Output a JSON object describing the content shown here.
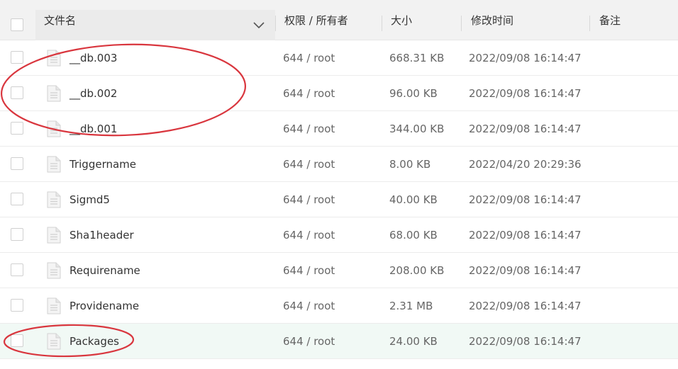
{
  "columns": {
    "name": "文件名",
    "perm": "权限 / 所有者",
    "size": "大小",
    "mtime": "修改时间",
    "note": "备注"
  },
  "rows": [
    {
      "name": "__db.003",
      "perm": "644 / root",
      "size": "668.31 KB",
      "mtime": "2022/09/08 16:14:47",
      "highlighted": false
    },
    {
      "name": "__db.002",
      "perm": "644 / root",
      "size": "96.00 KB",
      "mtime": "2022/09/08 16:14:47",
      "highlighted": false
    },
    {
      "name": "__db.001",
      "perm": "644 / root",
      "size": "344.00 KB",
      "mtime": "2022/09/08 16:14:47",
      "highlighted": false
    },
    {
      "name": "Triggername",
      "perm": "644 / root",
      "size": "8.00 KB",
      "mtime": "2022/04/20 20:29:36",
      "highlighted": false
    },
    {
      "name": "Sigmd5",
      "perm": "644 / root",
      "size": "40.00 KB",
      "mtime": "2022/09/08 16:14:47",
      "highlighted": false
    },
    {
      "name": "Sha1header",
      "perm": "644 / root",
      "size": "68.00 KB",
      "mtime": "2022/09/08 16:14:47",
      "highlighted": false
    },
    {
      "name": "Requirename",
      "perm": "644 / root",
      "size": "208.00 KB",
      "mtime": "2022/09/08 16:14:47",
      "highlighted": false
    },
    {
      "name": "Providename",
      "perm": "644 / root",
      "size": "2.31 MB",
      "mtime": "2022/09/08 16:14:47",
      "highlighted": false
    },
    {
      "name": "Packages",
      "perm": "644 / root",
      "size": "24.00 KB",
      "mtime": "2022/09/08 16:14:47",
      "highlighted": true
    }
  ],
  "icons": {
    "row": "file-icon",
    "sort": "chevron-down-icon"
  },
  "colors": {
    "annotation": "#d9363e",
    "highlight_row": "#f1f9f5",
    "header_bg": "#f2f2f2"
  }
}
